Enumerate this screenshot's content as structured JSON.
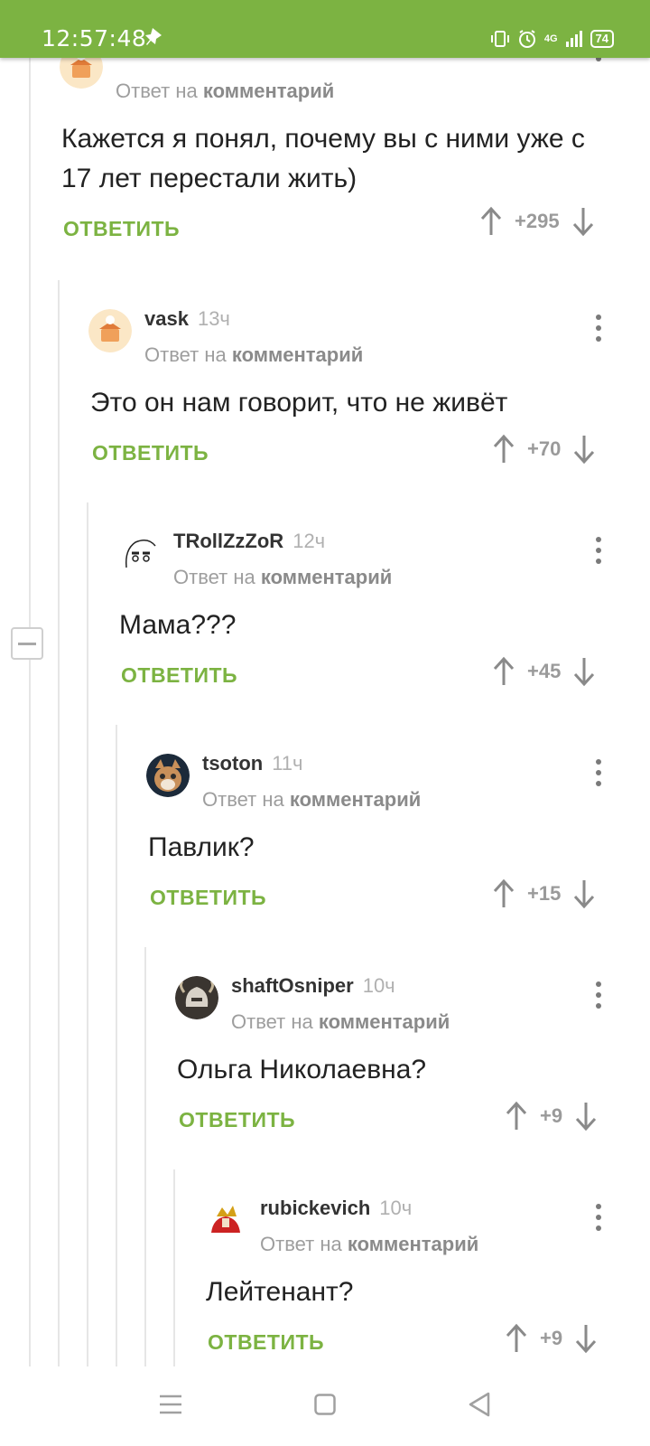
{
  "status_bar": {
    "time": "12:57:48",
    "battery": "74",
    "network": "4G"
  },
  "reply_to_prefix": "Ответ на",
  "reply_to_link": "комментарий",
  "reply_label": "ОТВЕТИТЬ",
  "comments": [
    {
      "user": "",
      "time": "",
      "text": "Кажется я понял, почему вы с ними уже с 17 лет перестали жить)",
      "score": "+295"
    },
    {
      "user": "vask",
      "time": "13ч",
      "text": "Это он нам говорит, что не живёт",
      "score": "+70"
    },
    {
      "user": "TRollZzZoR",
      "time": "12ч",
      "text": "Мама???",
      "score": "+45"
    },
    {
      "user": "tsoton",
      "time": "11ч",
      "text": "Павлик?",
      "score": "+15"
    },
    {
      "user": "shaftOsniper",
      "time": "10ч",
      "text": "Ольга Николаевна?",
      "score": "+9"
    },
    {
      "user": "rubickevich",
      "time": "10ч",
      "text": "Лейтенант?",
      "score": "+9"
    }
  ]
}
